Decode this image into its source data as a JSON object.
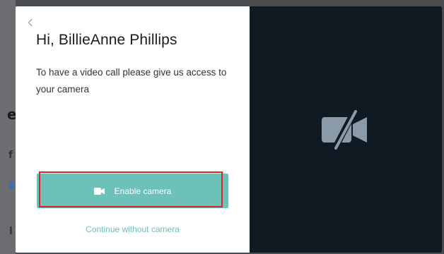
{
  "dialog": {
    "greeting": "Hi, BillieAnne Phillips",
    "message": "To have a video call please give us access to your camera",
    "enable_label": "Enable camera",
    "continue_label": "Continue without camera"
  },
  "icons": {
    "back": "chevron-left-icon",
    "enable": "video-camera-icon",
    "preview": "camera-off-icon"
  },
  "colors": {
    "accent": "#6cc1b9",
    "preview_bg": "#101a23",
    "highlight": "#d8242a",
    "camera_off_icon": "#8a9aa8"
  }
}
